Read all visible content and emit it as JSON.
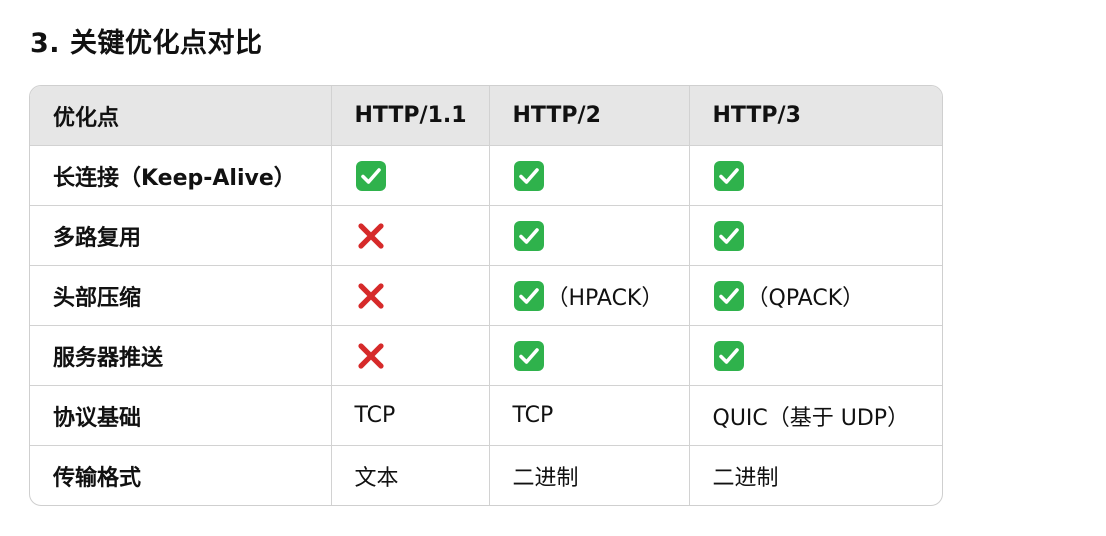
{
  "heading": "3. 关键优化点对比",
  "table": {
    "headers": [
      "优化点",
      "HTTP/1.1",
      "HTTP/2",
      "HTTP/3"
    ],
    "rows": [
      {
        "feature": "长连接（Keep-Alive）",
        "cells": [
          {
            "mark": "check",
            "icon": "check-mark-icon",
            "note": ""
          },
          {
            "mark": "check",
            "icon": "check-mark-icon",
            "note": ""
          },
          {
            "mark": "check",
            "icon": "check-mark-icon",
            "note": ""
          }
        ]
      },
      {
        "feature": "多路复用",
        "cells": [
          {
            "mark": "cross",
            "icon": "cross-mark-icon",
            "note": ""
          },
          {
            "mark": "check",
            "icon": "check-mark-icon",
            "note": ""
          },
          {
            "mark": "check",
            "icon": "check-mark-icon",
            "note": ""
          }
        ]
      },
      {
        "feature": "头部压缩",
        "cells": [
          {
            "mark": "cross",
            "icon": "cross-mark-icon",
            "note": ""
          },
          {
            "mark": "check",
            "icon": "check-mark-icon",
            "note": "（HPACK）"
          },
          {
            "mark": "check",
            "icon": "check-mark-icon",
            "note": "（QPACK）"
          }
        ]
      },
      {
        "feature": "服务器推送",
        "cells": [
          {
            "mark": "cross",
            "icon": "cross-mark-icon",
            "note": ""
          },
          {
            "mark": "check",
            "icon": "check-mark-icon",
            "note": ""
          },
          {
            "mark": "check",
            "icon": "check-mark-icon",
            "note": ""
          }
        ]
      },
      {
        "feature": "协议基础",
        "cells": [
          {
            "text": "TCP"
          },
          {
            "text": "TCP"
          },
          {
            "text": "QUIC（基于 UDP）"
          }
        ]
      },
      {
        "feature": "传输格式",
        "cells": [
          {
            "text": "文本"
          },
          {
            "text": "二进制"
          },
          {
            "text": "二进制"
          }
        ]
      }
    ]
  },
  "colors": {
    "check_bg": "#2fb24c",
    "cross": "#d62a2a",
    "header_bg": "#e6e6e6",
    "border": "#d2d2d2"
  }
}
